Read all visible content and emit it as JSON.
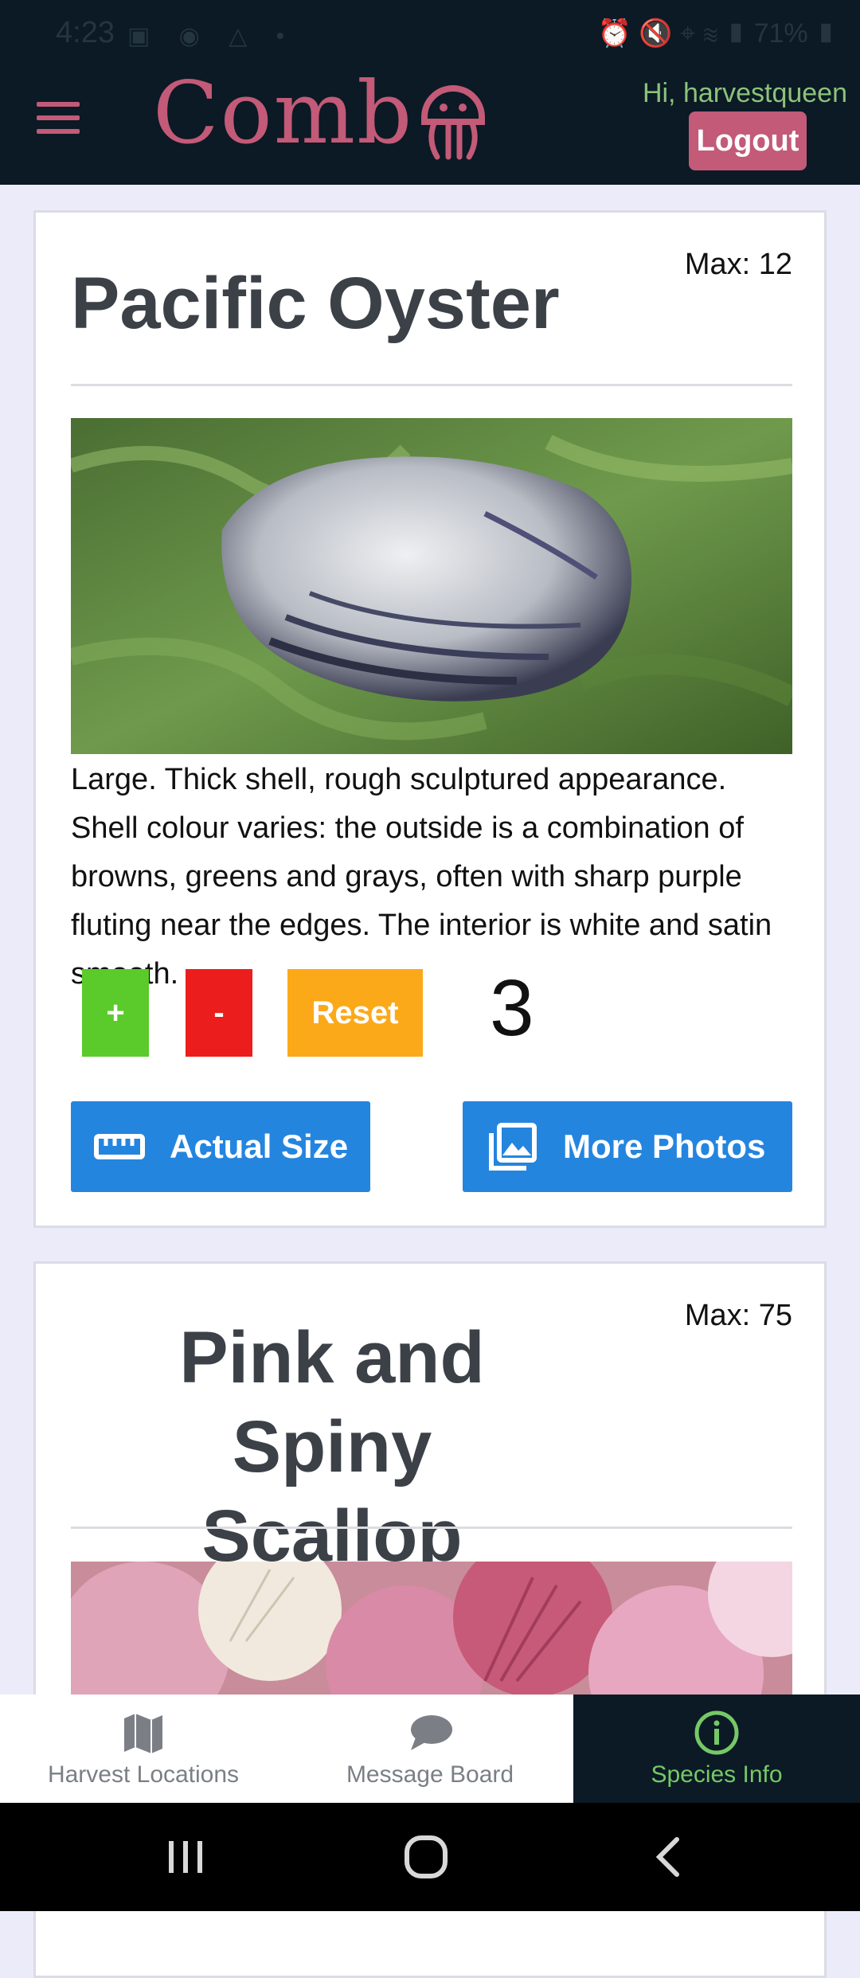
{
  "status_bar": {
    "time": "4:23",
    "battery": "71%"
  },
  "header": {
    "logo_text": "Comb",
    "greeting": "Hi, harvestqueen",
    "logout_label": "Logout",
    "accent_color": "#c25a78",
    "background": "#0b1a25"
  },
  "species": [
    {
      "title": "Pacific Oyster",
      "max": "Max: 12",
      "description": "Large. Thick shell, rough sculptured appearance. Shell colour varies: the outside is a combination of browns, greens and grays, often with sharp purple fluting near the edges. The interior is white and satin smooth.",
      "plus_label": "+",
      "minus_label": "-",
      "reset_label": "Reset",
      "count": "3",
      "actual_size_label": "Actual Size",
      "more_photos_label": "More Photos"
    },
    {
      "title_line1": "Pink and Spiny",
      "title_line2": "Scallop",
      "max": "Max: 75"
    }
  ],
  "bottom_nav": {
    "items": [
      {
        "label": "Harvest Locations",
        "icon": "map-icon"
      },
      {
        "label": "Message Board",
        "icon": "chat-icon"
      },
      {
        "label": "Species Info",
        "icon": "info-icon"
      }
    ],
    "active": "Species Info"
  },
  "colors": {
    "plus": "#5acb2a",
    "minus": "#ec1d1d",
    "reset": "#fca919",
    "action": "#2485df",
    "active_nav": "#76c867"
  }
}
